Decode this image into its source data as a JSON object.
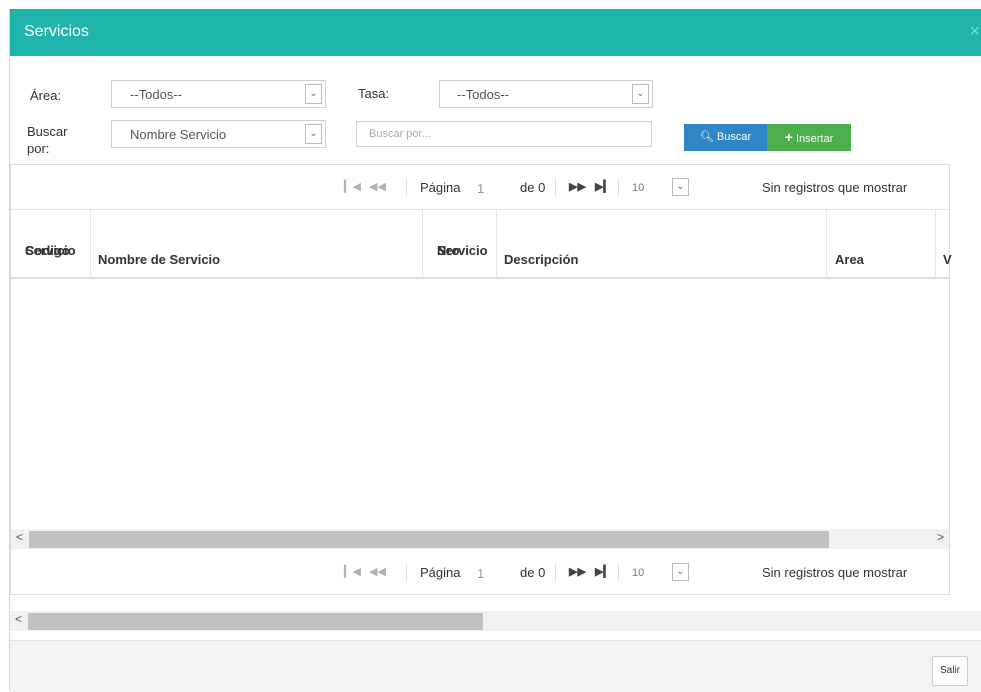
{
  "header": {
    "title": "Servicios",
    "close": "×"
  },
  "filters": {
    "area_label": "Área:",
    "area_value": "--Todos--",
    "tasa_label": "Tasa:",
    "tasa_value": "--Todos--",
    "buscar_label_1": "Buscar",
    "buscar_label_2": "por:",
    "buscar_field_value": "Nombre Servicio",
    "search_placeholder": "Buscar por...",
    "buscar_button": "Buscar",
    "insertar_button": "Insertar"
  },
  "pager": {
    "page_label": "Página",
    "page_value": "1",
    "of_label": "de 0",
    "page_size": "10",
    "status": "Sin registros que mostrar"
  },
  "table": {
    "columns": [
      {
        "line1": "Codigo",
        "line2": "Servicio"
      },
      {
        "line1": "",
        "line2": "Nombre de Servicio"
      },
      {
        "line1": "Nro",
        "line2": "Servicio"
      },
      {
        "line1": "",
        "line2": "Descripción"
      },
      {
        "line1": "",
        "line2": "Area"
      },
      {
        "line1": "",
        "line2": "V"
      }
    ],
    "rows": []
  },
  "footer": {
    "salir_button": "Salir"
  },
  "colors": {
    "header": "#1fb5ad",
    "buscar": "#2f86c6",
    "insertar": "#4cae4c"
  },
  "icons": [
    "close-icon",
    "search-icon",
    "plus-icon",
    "chevron-down-icon",
    "first-page-icon",
    "prev-page-icon",
    "next-page-icon",
    "last-page-icon",
    "scroll-left-icon",
    "scroll-right-icon"
  ]
}
